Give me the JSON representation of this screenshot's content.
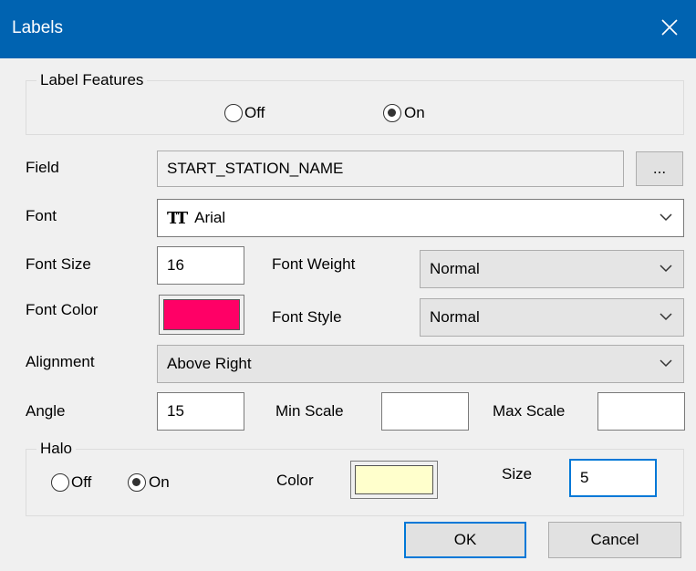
{
  "window": {
    "title": "Labels"
  },
  "label_features": {
    "legend": "Label Features",
    "off_label": "Off",
    "on_label": "On",
    "selected": "On"
  },
  "field": {
    "label": "Field",
    "value": "START_STATION_NAME",
    "browse_label": "..."
  },
  "font": {
    "label": "Font",
    "value": "Arial",
    "icon": "truetype-font-icon"
  },
  "font_size": {
    "label": "Font Size",
    "value": "16"
  },
  "font_weight": {
    "label": "Font Weight",
    "value": "Normal"
  },
  "font_color": {
    "label": "Font Color",
    "color": "#ff0066"
  },
  "font_style": {
    "label": "Font Style",
    "value": "Normal"
  },
  "alignment": {
    "label": "Alignment",
    "value": "Above Right"
  },
  "angle": {
    "label": "Angle",
    "value": "15"
  },
  "min_scale": {
    "label": "Min Scale",
    "value": ""
  },
  "max_scale": {
    "label": "Max Scale",
    "value": ""
  },
  "halo": {
    "legend": "Halo",
    "off_label": "Off",
    "on_label": "On",
    "selected": "On",
    "color_label": "Color",
    "color": "#ffffcc",
    "size_label": "Size",
    "size_value": "5"
  },
  "buttons": {
    "ok": "OK",
    "cancel": "Cancel"
  },
  "colors": {
    "titlebar": "#0063b1",
    "accent": "#0078d7"
  }
}
